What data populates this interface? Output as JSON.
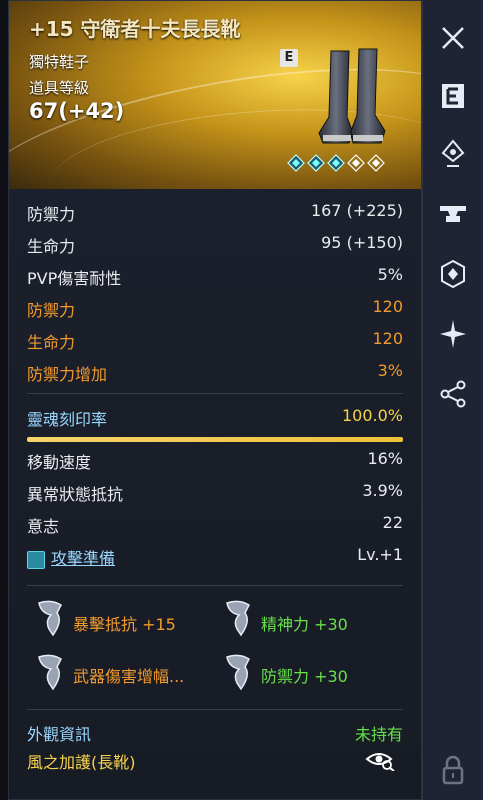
{
  "item": {
    "name": "+15 守衛者十夫長長靴",
    "grade": "獨特鞋子",
    "level_label": "道具等級",
    "level_value": "67(+42)",
    "badge": "E"
  },
  "stats": [
    {
      "label": "防禦力",
      "value": "167 (+225)"
    },
    {
      "label": "生命力",
      "value": "95 (+150)"
    },
    {
      "label": "PVP傷害耐性",
      "value": "5%"
    }
  ],
  "bonus_stats": [
    {
      "label": "防禦力",
      "value": "120"
    },
    {
      "label": "生命力",
      "value": "120"
    },
    {
      "label": "防禦力增加",
      "value": "3%"
    }
  ],
  "soul": {
    "label": "靈魂刻印率",
    "value": "100.0%",
    "fill": 1.0
  },
  "extra_stats": [
    {
      "label": "移動速度",
      "value": "16%"
    },
    {
      "label": "異常狀態抵抗",
      "value": "3.9%"
    },
    {
      "label": "意志",
      "value": "22"
    },
    {
      "label": "攻擊準備",
      "value": "Lv.+1"
    }
  ],
  "runes": [
    {
      "text": "暴擊抵抗 +15"
    },
    {
      "text": "精神力 +30"
    },
    {
      "text": "武器傷害增幅..."
    },
    {
      "text": "防禦力 +30"
    }
  ],
  "appearance": {
    "label": "外觀資訊",
    "status": "未持有",
    "item": "風之加護(長靴)"
  },
  "sidebar": {
    "icons": [
      "close-icon",
      "e-icon",
      "pin-icon",
      "anvil-icon",
      "gem-icon",
      "star-icon",
      "share-icon",
      "lock-icon"
    ]
  },
  "colors": {
    "gold": "#f7d24d",
    "orange": "#f19a2e",
    "cyan": "#9ad7ff",
    "green": "#66e04a"
  }
}
